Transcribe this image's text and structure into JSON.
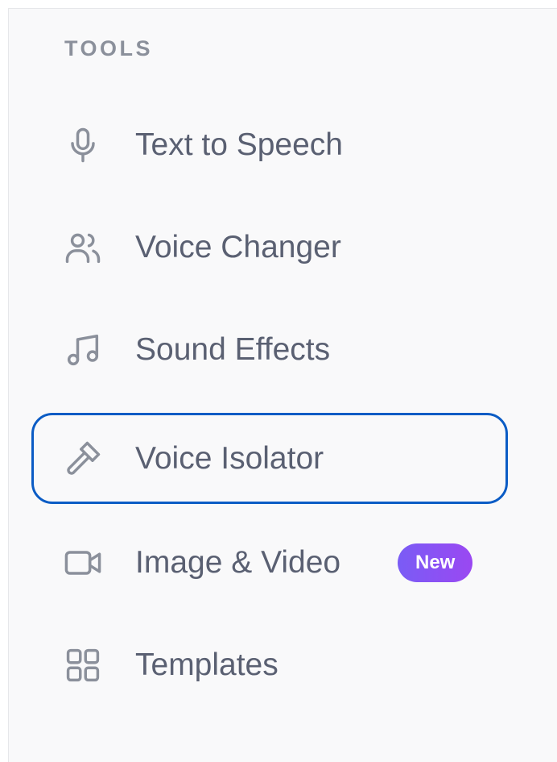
{
  "sidebar": {
    "section_title": "TOOLS",
    "items": [
      {
        "label": "Text to Speech",
        "icon": "microphone-icon"
      },
      {
        "label": "Voice Changer",
        "icon": "users-icon"
      },
      {
        "label": "Sound Effects",
        "icon": "music-note-icon"
      },
      {
        "label": "Voice Isolator",
        "icon": "hammer-icon",
        "focused": true
      },
      {
        "label": "Image & Video",
        "icon": "video-camera-icon",
        "badge": "New"
      },
      {
        "label": "Templates",
        "icon": "grid-icon"
      }
    ]
  },
  "colors": {
    "panel_background": "#f9f9fa",
    "section_title": "#8b909b",
    "label": "#5a6072",
    "icon": "#8b909b",
    "focus_ring": "#0b5cc5",
    "badge_gradient_start": "#7a5cf5",
    "badge_gradient_end": "#9a48f2",
    "badge_text": "#ffffff"
  }
}
